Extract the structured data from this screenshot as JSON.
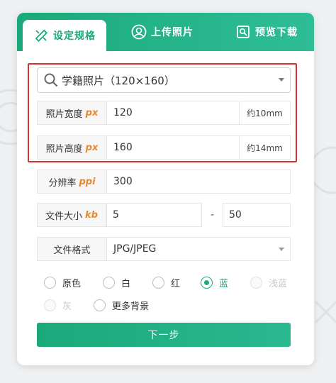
{
  "tabs": [
    {
      "label": "设定规格",
      "icon": "ruler-pencil-icon",
      "active": true
    },
    {
      "label": "上传照片",
      "icon": "portrait-upload-icon",
      "active": false
    },
    {
      "label": "预览下载",
      "icon": "preview-download-icon",
      "active": false
    }
  ],
  "spec_select": {
    "value": "学籍照片（120×160）",
    "icon": "search-icon"
  },
  "width": {
    "label": "照片宽度",
    "unit": "px",
    "value": "120",
    "suffix": "约10mm"
  },
  "height": {
    "label": "照片高度",
    "unit": "px",
    "value": "160",
    "suffix": "约14mm"
  },
  "resolution": {
    "label": "分辨率",
    "unit": "ppi",
    "value": "300"
  },
  "file_size": {
    "label": "文件大小",
    "unit": "kb",
    "min": "5",
    "separator": "-",
    "max": "50"
  },
  "format": {
    "label": "文件格式",
    "value": "JPG/JPEG"
  },
  "background_options": [
    {
      "label": "原色",
      "state": "normal"
    },
    {
      "label": "白",
      "state": "normal"
    },
    {
      "label": "红",
      "state": "normal"
    },
    {
      "label": "蓝",
      "state": "checked"
    },
    {
      "label": "浅蓝",
      "state": "disabled"
    },
    {
      "label": "灰",
      "state": "disabled"
    },
    {
      "label": "更多背景",
      "state": "normal"
    }
  ],
  "submit_label": "下一步",
  "colors": {
    "accent": "#1aa97a",
    "highlight_border": "#d8322c",
    "unit_orange": "#e8892e"
  }
}
